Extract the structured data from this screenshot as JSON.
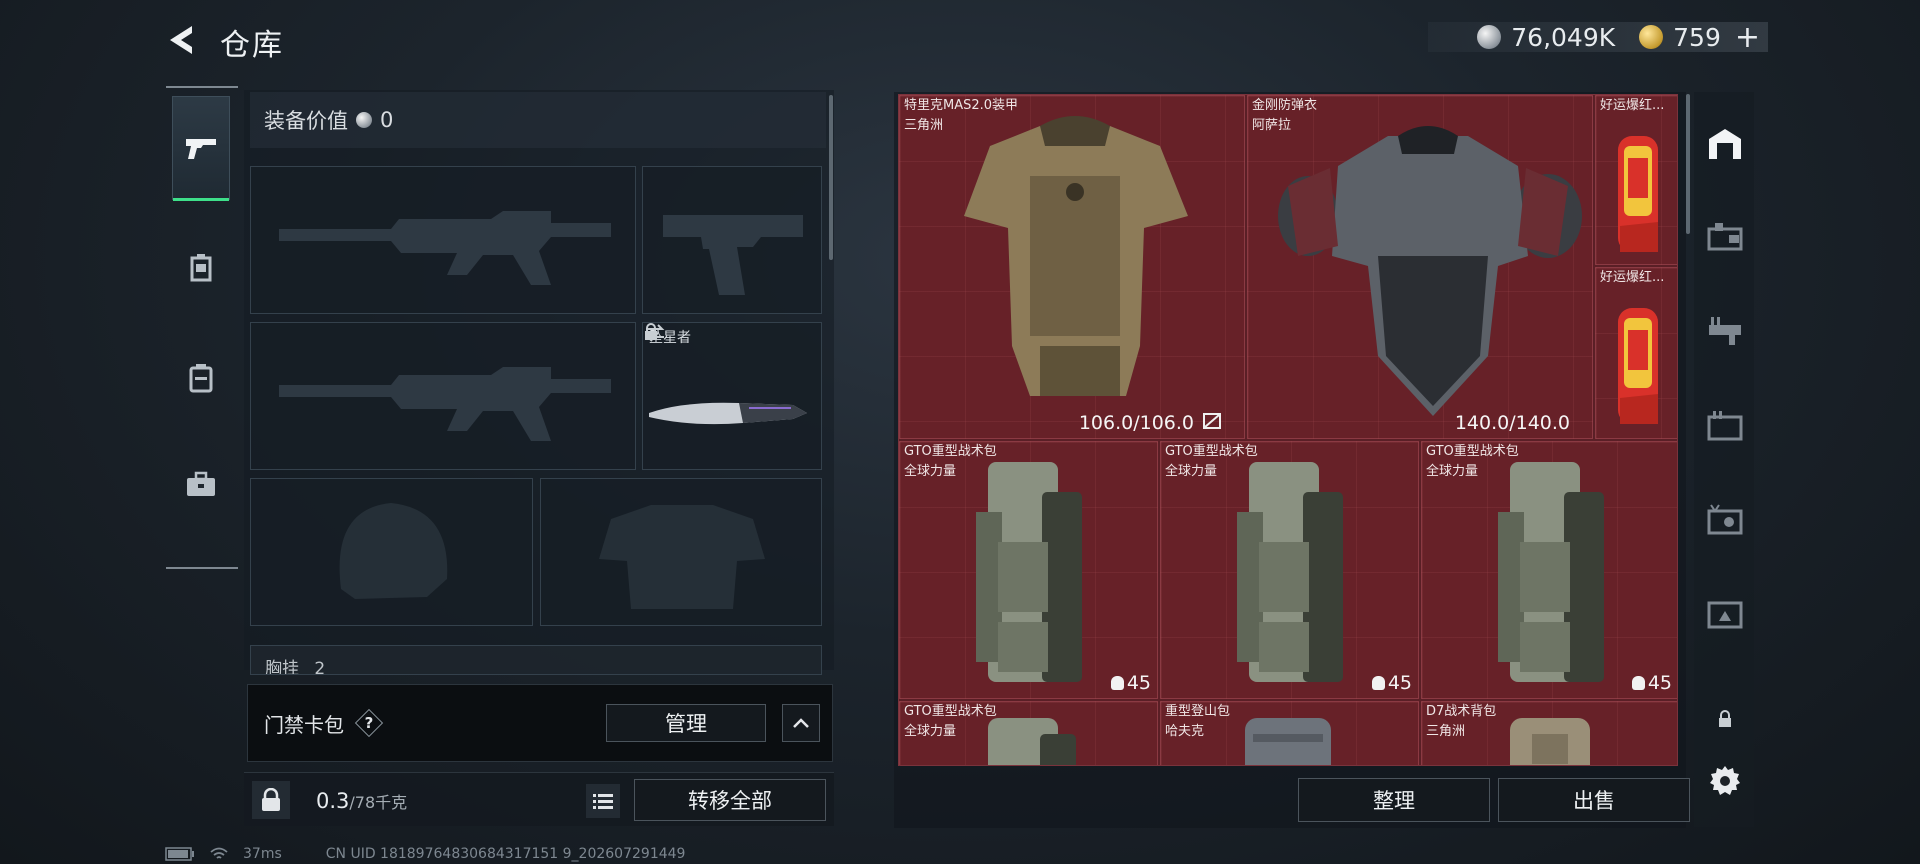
{
  "header": {
    "title": "仓库",
    "currency_silver": "76,049K",
    "currency_gold": "759",
    "plus": "+"
  },
  "equipment": {
    "value_label": "装备价值",
    "value": "0",
    "melee_name": "坠星者",
    "chest_label": "胸挂",
    "chest_count": "2"
  },
  "card_pack": {
    "title": "门禁卡包",
    "help": "?",
    "manage": "管理"
  },
  "bottom": {
    "weight": "0.3",
    "weight_max": "/78千克",
    "transfer_all": "转移全部"
  },
  "status": {
    "ping": "37ms",
    "uid": "CN UID 18189764830684317151 9_202607291449"
  },
  "storage": {
    "items": [
      {
        "name": "特里克MAS2.0装甲",
        "sub": "三角洲",
        "durability": "106.0/106.0"
      },
      {
        "name": "金刚防弹衣",
        "sub": "阿萨拉",
        "durability": "140.0/140.0"
      },
      {
        "name": "好运爆红...",
        "sub": ""
      },
      {
        "name": "好运爆红...",
        "sub": ""
      },
      {
        "name": "GTO重型战术包",
        "sub": "全球力量",
        "capacity": "45"
      },
      {
        "name": "GTO重型战术包",
        "sub": "全球力量",
        "capacity": "45"
      },
      {
        "name": "GTO重型战术包",
        "sub": "全球力量",
        "capacity": "45"
      },
      {
        "name": "GTO重型战术包",
        "sub": "全球力量"
      },
      {
        "name": "重型登山包",
        "sub": "哈夫克"
      },
      {
        "name": "D7战术背包",
        "sub": "三角洲"
      }
    ],
    "sort": "整理",
    "sell": "出售"
  },
  "colors": {
    "accent": "#3ee08a",
    "grid_bg": "#5a1f26"
  }
}
